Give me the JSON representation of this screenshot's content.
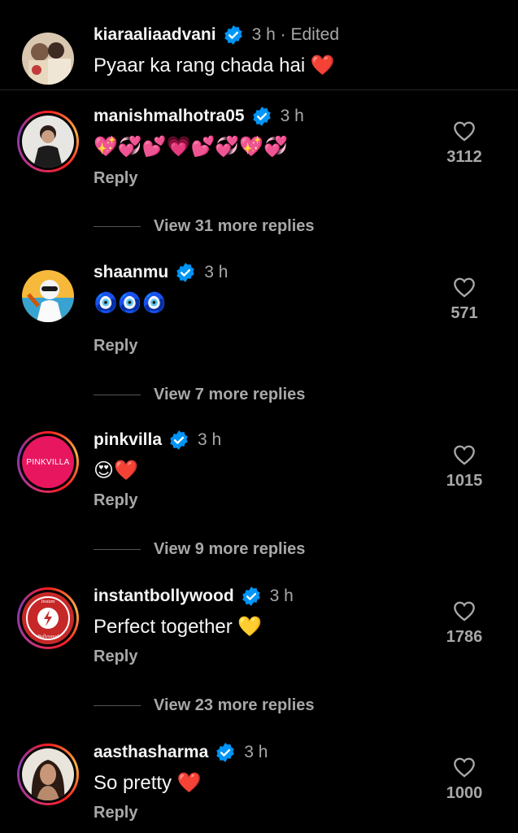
{
  "caption": {
    "username": "kiaraaliaadvani",
    "time": "3 h · Edited",
    "text": "Pyaar ka rang chada hai ❤️"
  },
  "comments": [
    {
      "username": "manishmalhotra05",
      "time": "3 h",
      "text": "💖💞💕💗💕💞💖💞",
      "reply_label": "Reply",
      "likes": "3112",
      "view_replies": "View 31 more replies"
    },
    {
      "username": "shaanmu",
      "time": "3 h",
      "text": "🧿🧿🧿",
      "reply_label": "Reply",
      "likes": "571",
      "view_replies": "View 7 more replies"
    },
    {
      "username": "pinkvilla",
      "time": "3 h",
      "text": "😍❤️",
      "reply_label": "Reply",
      "likes": "1015",
      "view_replies": "View 9 more replies",
      "avatar_text": "PINKVILLA"
    },
    {
      "username": "instantbollywood",
      "time": "3 h",
      "text": "Perfect together 💛",
      "reply_label": "Reply",
      "likes": "1786",
      "view_replies": "View 23 more replies"
    },
    {
      "username": "aasthasharma",
      "time": "3 h",
      "text": "So pretty ❤️",
      "reply_label": "Reply",
      "likes": "1000"
    }
  ],
  "colors": {
    "background": "#000000",
    "text_primary": "#f5f5f5",
    "text_secondary": "#a8a8a8",
    "verified_blue": "#0095f6",
    "heart_red": "#ed4956",
    "pinkvilla_pink": "#e8155f"
  },
  "icons": {
    "verified": "verified-badge-icon",
    "like": "heart-outline-icon"
  }
}
